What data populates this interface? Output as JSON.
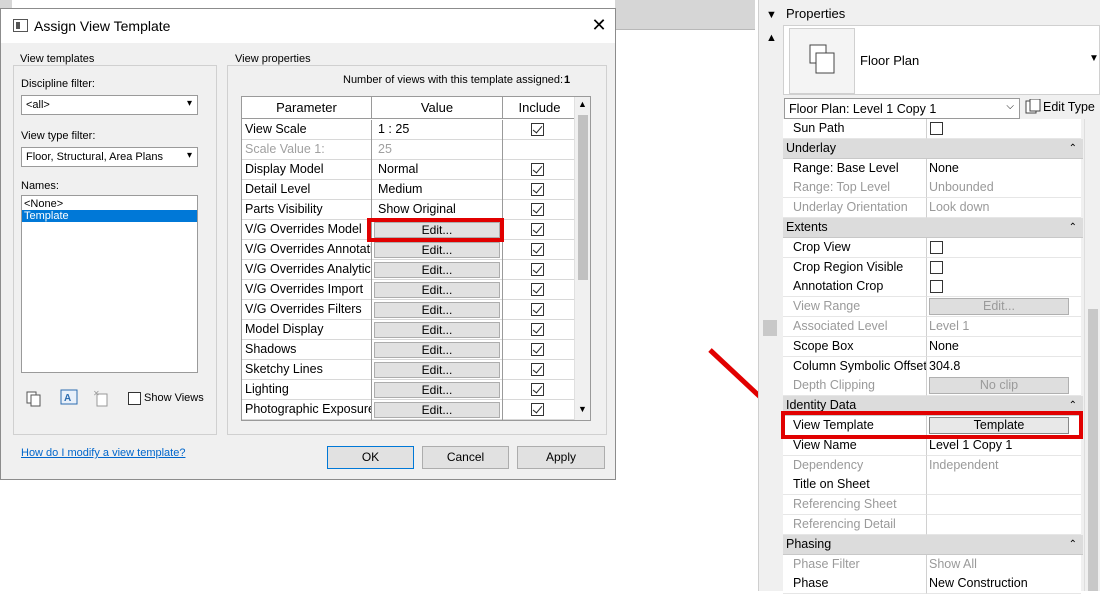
{
  "dialog": {
    "title": "Assign View Template",
    "close_glyph": "✕",
    "view_templates_group": "View templates",
    "discipline_filter_label": "Discipline filter:",
    "discipline_filter_value": "<all>",
    "view_type_filter_label": "View type filter:",
    "view_type_filter_value": "Floor, Structural, Area Plans",
    "names_label": "Names:",
    "names": [
      "<None>",
      "Template"
    ],
    "selected_name_index": 1,
    "show_views_label": "Show Views",
    "view_properties_group": "View properties",
    "views_assigned_label": "Number of views with this template assigned:",
    "views_assigned_count": "1",
    "table": {
      "headers": [
        "Parameter",
        "Value",
        "Include"
      ],
      "rows": [
        {
          "param": "View Scale",
          "value": "1 : 25",
          "include": true,
          "type": "text"
        },
        {
          "param": "Scale Value    1:",
          "value": "25",
          "include": null,
          "type": "gray"
        },
        {
          "param": "Display Model",
          "value": "Normal",
          "include": true,
          "type": "text"
        },
        {
          "param": "Detail Level",
          "value": "Medium",
          "include": true,
          "type": "text"
        },
        {
          "param": "Parts Visibility",
          "value": "Show Original",
          "include": true,
          "type": "text"
        },
        {
          "param": "V/G Overrides Model",
          "value": "Edit...",
          "include": true,
          "type": "button"
        },
        {
          "param": "V/G Overrides Annotati",
          "value": "Edit...",
          "include": true,
          "type": "button"
        },
        {
          "param": "V/G Overrides Analytic",
          "value": "Edit...",
          "include": true,
          "type": "button"
        },
        {
          "param": "V/G Overrides Import",
          "value": "Edit...",
          "include": true,
          "type": "button"
        },
        {
          "param": "V/G Overrides Filters",
          "value": "Edit...",
          "include": true,
          "type": "button"
        },
        {
          "param": "Model Display",
          "value": "Edit...",
          "include": true,
          "type": "button"
        },
        {
          "param": "Shadows",
          "value": "Edit...",
          "include": true,
          "type": "button"
        },
        {
          "param": "Sketchy Lines",
          "value": "Edit...",
          "include": true,
          "type": "button"
        },
        {
          "param": "Lighting",
          "value": "Edit...",
          "include": true,
          "type": "button"
        },
        {
          "param": "Photographic Exposure",
          "value": "Edit...",
          "include": true,
          "type": "button"
        }
      ]
    },
    "help_link": "How do I modify a view template?",
    "ok_label": "OK",
    "cancel_label": "Cancel",
    "apply_label": "Apply"
  },
  "properties": {
    "header": "Properties",
    "type_name": "Floor Plan",
    "instance_selector": "Floor Plan: Level 1 Copy 1",
    "edit_type_label": "Edit Type",
    "rows": [
      {
        "kind": "row",
        "name": "Sun Path",
        "value": "",
        "checkbox": true,
        "gray": false
      },
      {
        "kind": "group",
        "name": "Underlay"
      },
      {
        "kind": "row",
        "name": "Range: Base Level",
        "value": "None",
        "gray": false
      },
      {
        "kind": "row",
        "name": "Range: Top Level",
        "value": "Unbounded",
        "gray": true
      },
      {
        "kind": "row",
        "name": "Underlay Orientation",
        "value": "Look down",
        "gray": true
      },
      {
        "kind": "group",
        "name": "Extents"
      },
      {
        "kind": "row",
        "name": "Crop View",
        "value": "",
        "checkbox": true,
        "gray": false
      },
      {
        "kind": "row",
        "name": "Crop Region Visible",
        "value": "",
        "checkbox": true,
        "gray": false
      },
      {
        "kind": "row",
        "name": "Annotation Crop",
        "value": "",
        "checkbox": true,
        "gray": false
      },
      {
        "kind": "row",
        "name": "View Range",
        "value": "Edit...",
        "button": true,
        "gray": true
      },
      {
        "kind": "row",
        "name": "Associated Level",
        "value": "Level 1",
        "gray": true
      },
      {
        "kind": "row",
        "name": "Scope Box",
        "value": "None",
        "gray": false
      },
      {
        "kind": "row",
        "name": "Column Symbolic Offset",
        "value": "304.8",
        "gray": false
      },
      {
        "kind": "row",
        "name": "Depth Clipping",
        "value": "No clip",
        "button": true,
        "gray": true
      },
      {
        "kind": "group",
        "name": "Identity Data"
      },
      {
        "kind": "row",
        "name": "View Template",
        "value": "Template",
        "button": true,
        "gray": false
      },
      {
        "kind": "row",
        "name": "View Name",
        "value": "Level 1 Copy 1",
        "gray": false
      },
      {
        "kind": "row",
        "name": "Dependency",
        "value": "Independent",
        "gray": true
      },
      {
        "kind": "row",
        "name": "Title on Sheet",
        "value": "",
        "gray": false
      },
      {
        "kind": "row",
        "name": "Referencing Sheet",
        "value": "",
        "gray": true
      },
      {
        "kind": "row",
        "name": "Referencing Detail",
        "value": "",
        "gray": true
      },
      {
        "kind": "group",
        "name": "Phasing"
      },
      {
        "kind": "row",
        "name": "Phase Filter",
        "value": "Show All",
        "gray": true
      },
      {
        "kind": "row",
        "name": "Phase",
        "value": "New Construction",
        "gray": false
      }
    ]
  },
  "colors": {
    "highlight": "#e10000",
    "selection": "#0078d7"
  },
  "icons": [
    "close-icon",
    "dropdown-arrow-icon",
    "duplicate-icon",
    "rename-icon",
    "delete-icon",
    "floor-plan-icon",
    "edit-type-icon",
    "collapse-icon",
    "red-arrow-icon"
  ]
}
